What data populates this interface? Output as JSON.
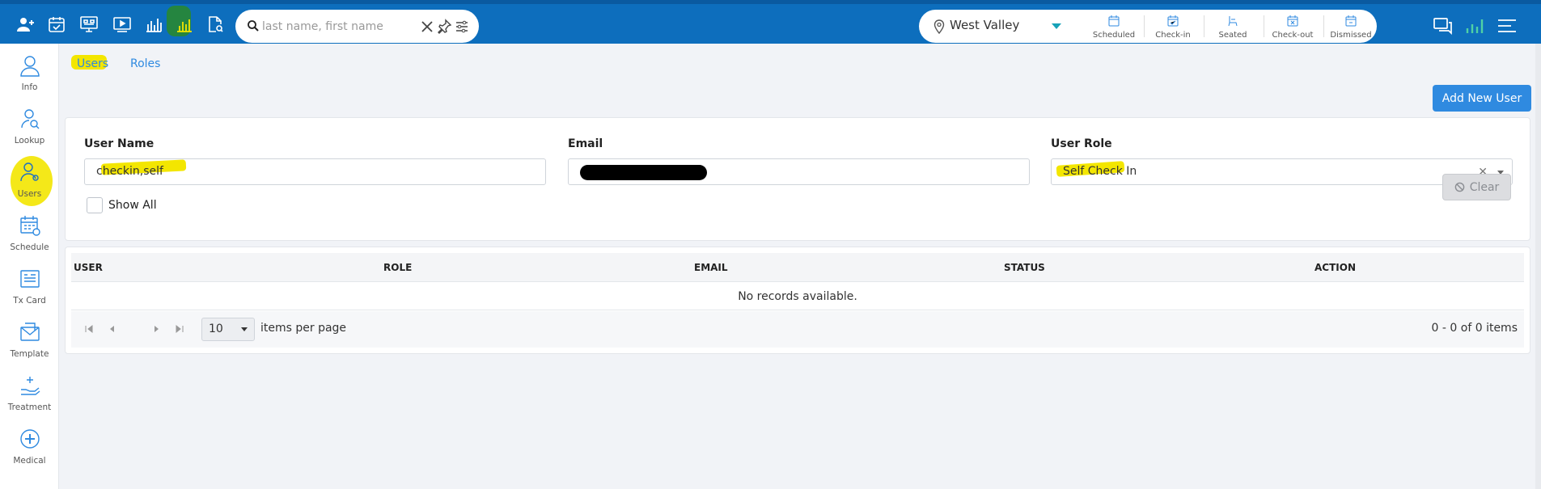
{
  "topbar": {
    "left_icons": [
      "add-user-icon",
      "calendar-check-icon",
      "monitor-grid-icon",
      "video-icon",
      "bar-chart-icon",
      "report-chart-icon",
      "document-search-icon"
    ],
    "search": {
      "placeholder": "last name, first name"
    },
    "location": {
      "name": "West Valley"
    },
    "statuses": [
      {
        "label": "Scheduled",
        "icon": "calendar-icon"
      },
      {
        "label": "Check-in",
        "icon": "calendar-check-icon"
      },
      {
        "label": "Seated",
        "icon": "chair-icon"
      },
      {
        "label": "Check-out",
        "icon": "calendar-x-icon"
      },
      {
        "label": "Dismissed",
        "icon": "calendar-dismiss-icon"
      }
    ],
    "right_icons": [
      "chat-icon",
      "signal-chart-icon",
      "menu-icon"
    ],
    "brand_color": "#0d6ebd"
  },
  "sidebar": {
    "items": [
      {
        "label": "Info",
        "icon": "person-icon"
      },
      {
        "label": "Lookup",
        "icon": "person-search-icon"
      },
      {
        "label": "Users",
        "icon": "users-settings-icon"
      },
      {
        "label": "Schedule",
        "icon": "schedule-icon"
      },
      {
        "label": "Tx Card",
        "icon": "card-icon"
      },
      {
        "label": "Template",
        "icon": "envelope-icon"
      },
      {
        "label": "Treatment",
        "icon": "hand-icon"
      },
      {
        "label": "Medical",
        "icon": "medical-plus-icon"
      }
    ]
  },
  "tabs": [
    "Users",
    "Roles"
  ],
  "add_button": "Add New User",
  "filters": {
    "user_name": {
      "label": "User Name",
      "value": "checkin,self"
    },
    "email": {
      "label": "Email",
      "value": ""
    },
    "user_role": {
      "label": "User Role",
      "value": "Self Check In"
    },
    "show_all": "Show All",
    "clear": "Clear"
  },
  "grid": {
    "columns": [
      "USER",
      "ROLE",
      "EMAIL",
      "STATUS",
      "ACTION"
    ],
    "empty": "No records available.",
    "page_size": "10",
    "items_per_page": "items per page",
    "info": "0 - 0 of 0 items"
  },
  "accent_color": "#2f8ae0",
  "highlight_color": "#f3e600"
}
